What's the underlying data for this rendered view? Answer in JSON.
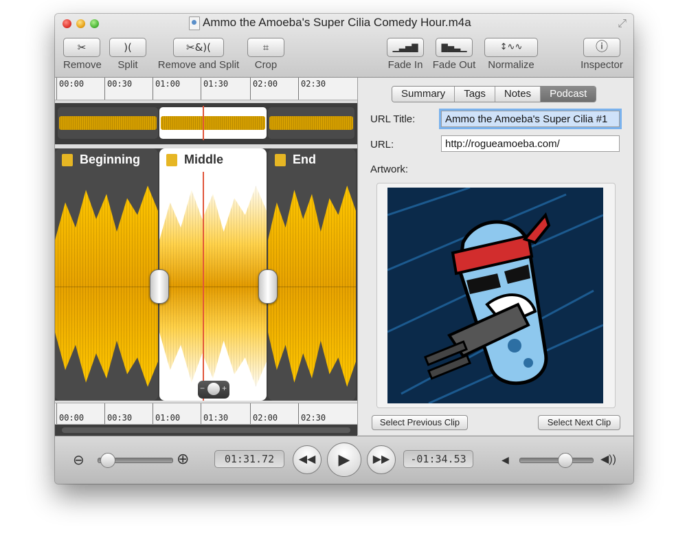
{
  "window": {
    "title": "Ammo the Amoeba's Super Cilia Comedy Hour.m4a"
  },
  "toolbar": {
    "remove": {
      "label": "Remove",
      "glyph": "✂"
    },
    "split": {
      "label": "Split",
      "glyph": ")("
    },
    "remove_split": {
      "label": "Remove and Split",
      "glyph": "✂&)("
    },
    "crop": {
      "label": "Crop",
      "glyph": "⌗"
    },
    "fade_in": {
      "label": "Fade In",
      "glyph": "▁▃▅▇"
    },
    "fade_out": {
      "label": "Fade Out",
      "glyph": "▇▅▃▁"
    },
    "normalize": {
      "label": "Normalize",
      "glyph": "↕∿∿"
    },
    "inspector": {
      "label": "Inspector",
      "glyph": "ⓘ"
    }
  },
  "ruler": {
    "ticks": [
      "00:00",
      "00:30",
      "01:00",
      "01:30",
      "02:00",
      "02:30"
    ]
  },
  "clips": [
    {
      "name": "Beginning"
    },
    {
      "name": "Middle"
    },
    {
      "name": "End"
    }
  ],
  "inspector": {
    "tabs": [
      "Summary",
      "Tags",
      "Notes",
      "Podcast"
    ],
    "active_tab": "Podcast",
    "url_title_label": "URL Title:",
    "url_title_value": "Ammo the Amoeba's Super Cilia #1",
    "url_label": "URL:",
    "url_value": "http://rogueamoeba.com/",
    "artwork_label": "Artwork:",
    "prev_clip": "Select Previous Clip",
    "next_clip": "Select Next Clip"
  },
  "transport": {
    "elapsed": "01:31.72",
    "remaining": "-01:34.53",
    "zoom_level": 0.05,
    "volume_level": 0.65
  },
  "colors": {
    "waveform": "#ffc800",
    "selected_clip_bg": "#ffffff",
    "playhead": "#e0543a",
    "tab_active": "#7a7a7a"
  }
}
